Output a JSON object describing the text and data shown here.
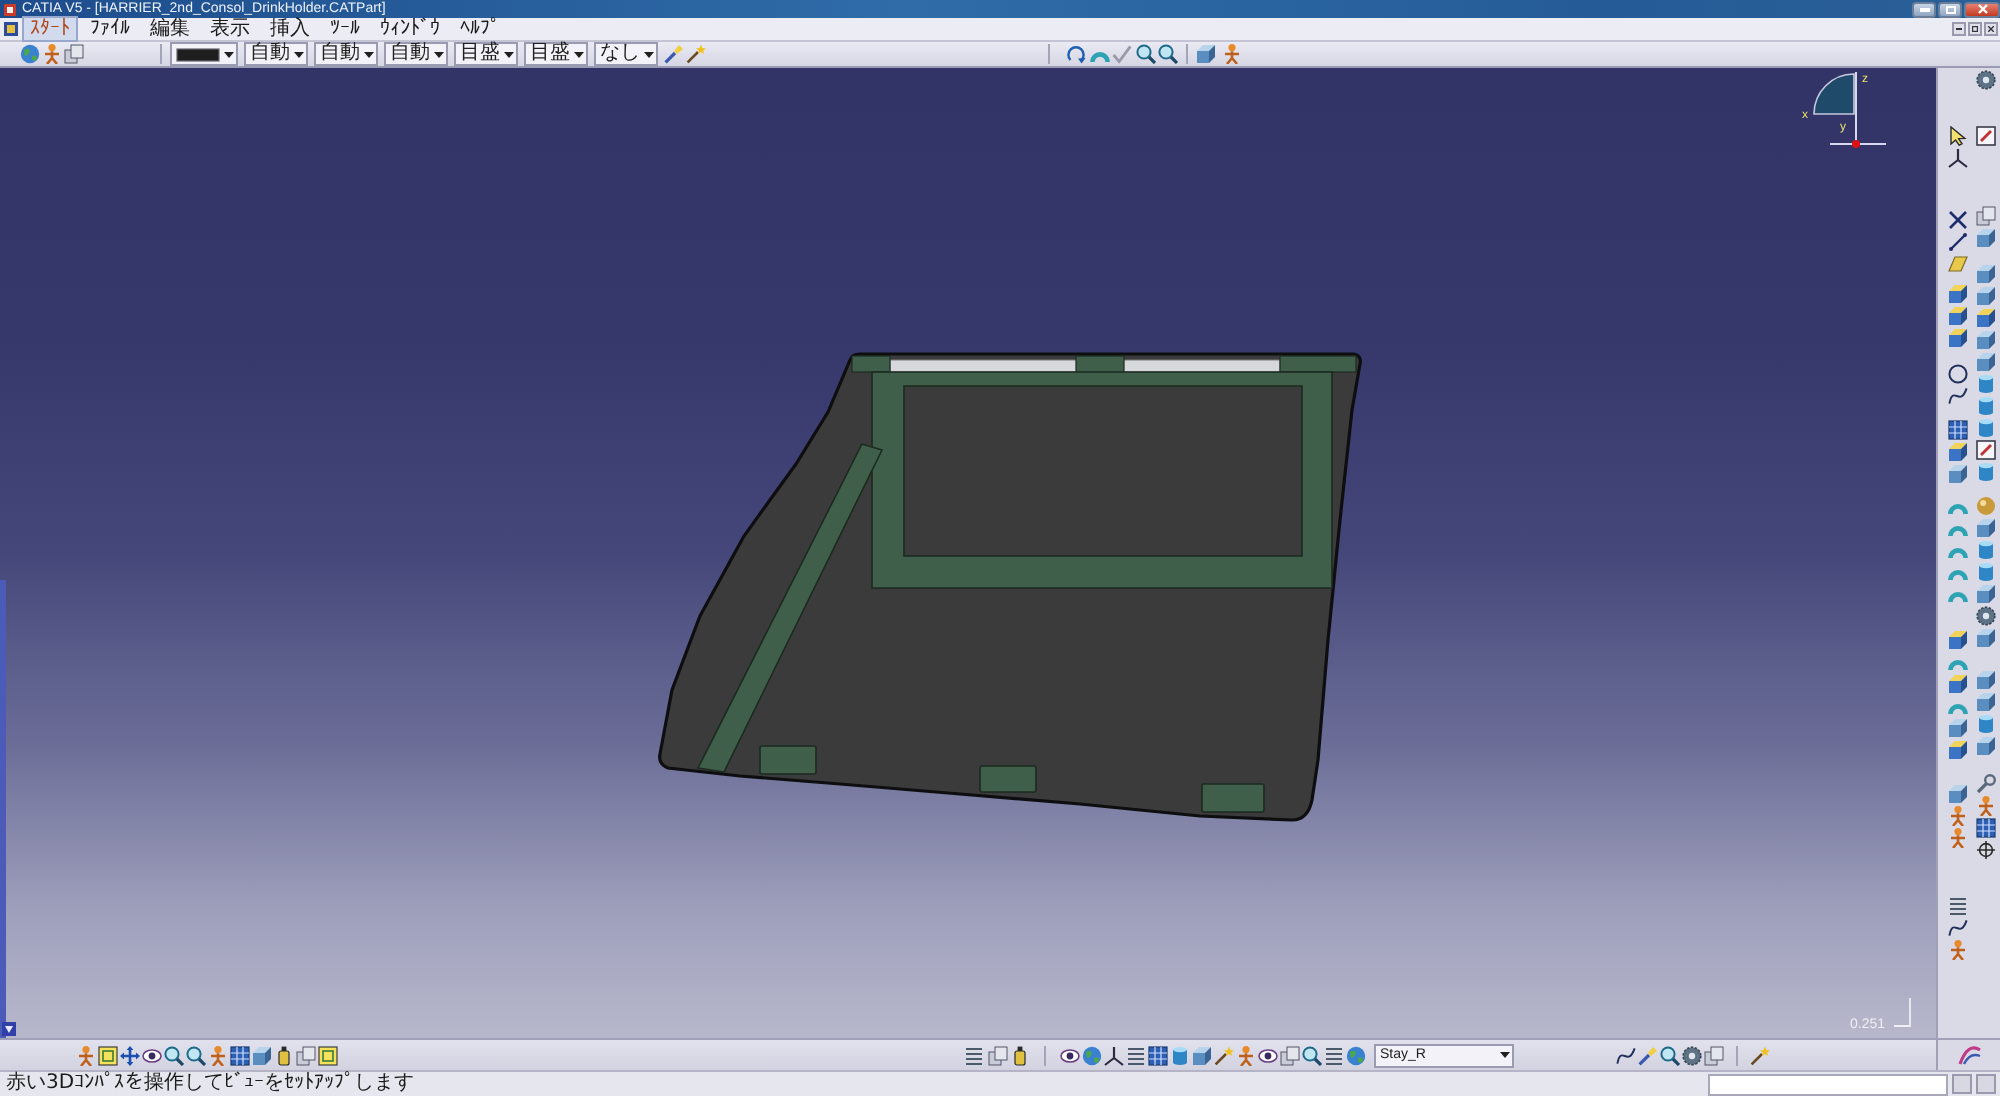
{
  "window": {
    "title": "CATIA V5 - [HARRIER_2nd_Consol_DrinkHolder.CATPart]"
  },
  "menu_bar": {
    "items": [
      {
        "label": "ｽﾀｰﾄ",
        "selected": true
      },
      {
        "label": "ﾌｧｲﾙ",
        "selected": false
      },
      {
        "label": "編集",
        "selected": false
      },
      {
        "label": "表示",
        "selected": false
      },
      {
        "label": "挿入",
        "selected": false
      },
      {
        "label": "ﾂｰﾙ",
        "selected": false
      },
      {
        "label": "ｳｨﾝﾄﾞｳ",
        "selected": false
      },
      {
        "label": "ﾍﾙﾌﾟ",
        "selected": false
      }
    ]
  },
  "graphic_properties": {
    "dropdowns": [
      "自動",
      "自動",
      "自動",
      "目盛",
      "目盛",
      "なし"
    ]
  },
  "viewport": {
    "compass": {
      "z_label": "z",
      "x_label": "x",
      "y_label": "y"
    },
    "scale": "0.251"
  },
  "bottom_toolbar": {
    "combo": "Stay_R"
  },
  "status_bar": {
    "message": "赤い3Dｺﾝﾊﾟｽを操作してﾋﾞｭｰをｾｯﾄｱｯﾌﾟします"
  }
}
